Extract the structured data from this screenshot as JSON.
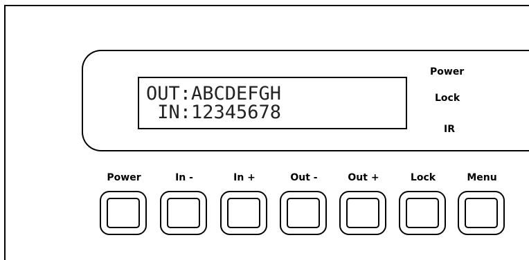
{
  "lcd": {
    "line1": "OUT:ABCDEFGH",
    "line2": " IN:12345678"
  },
  "indicators": {
    "power": "Power",
    "lock": "Lock",
    "ir": "IR"
  },
  "buttons": [
    {
      "label": "Power"
    },
    {
      "label": "In -"
    },
    {
      "label": "In +"
    },
    {
      "label": "Out -"
    },
    {
      "label": "Out +"
    },
    {
      "label": "Lock"
    },
    {
      "label": "Menu"
    }
  ]
}
